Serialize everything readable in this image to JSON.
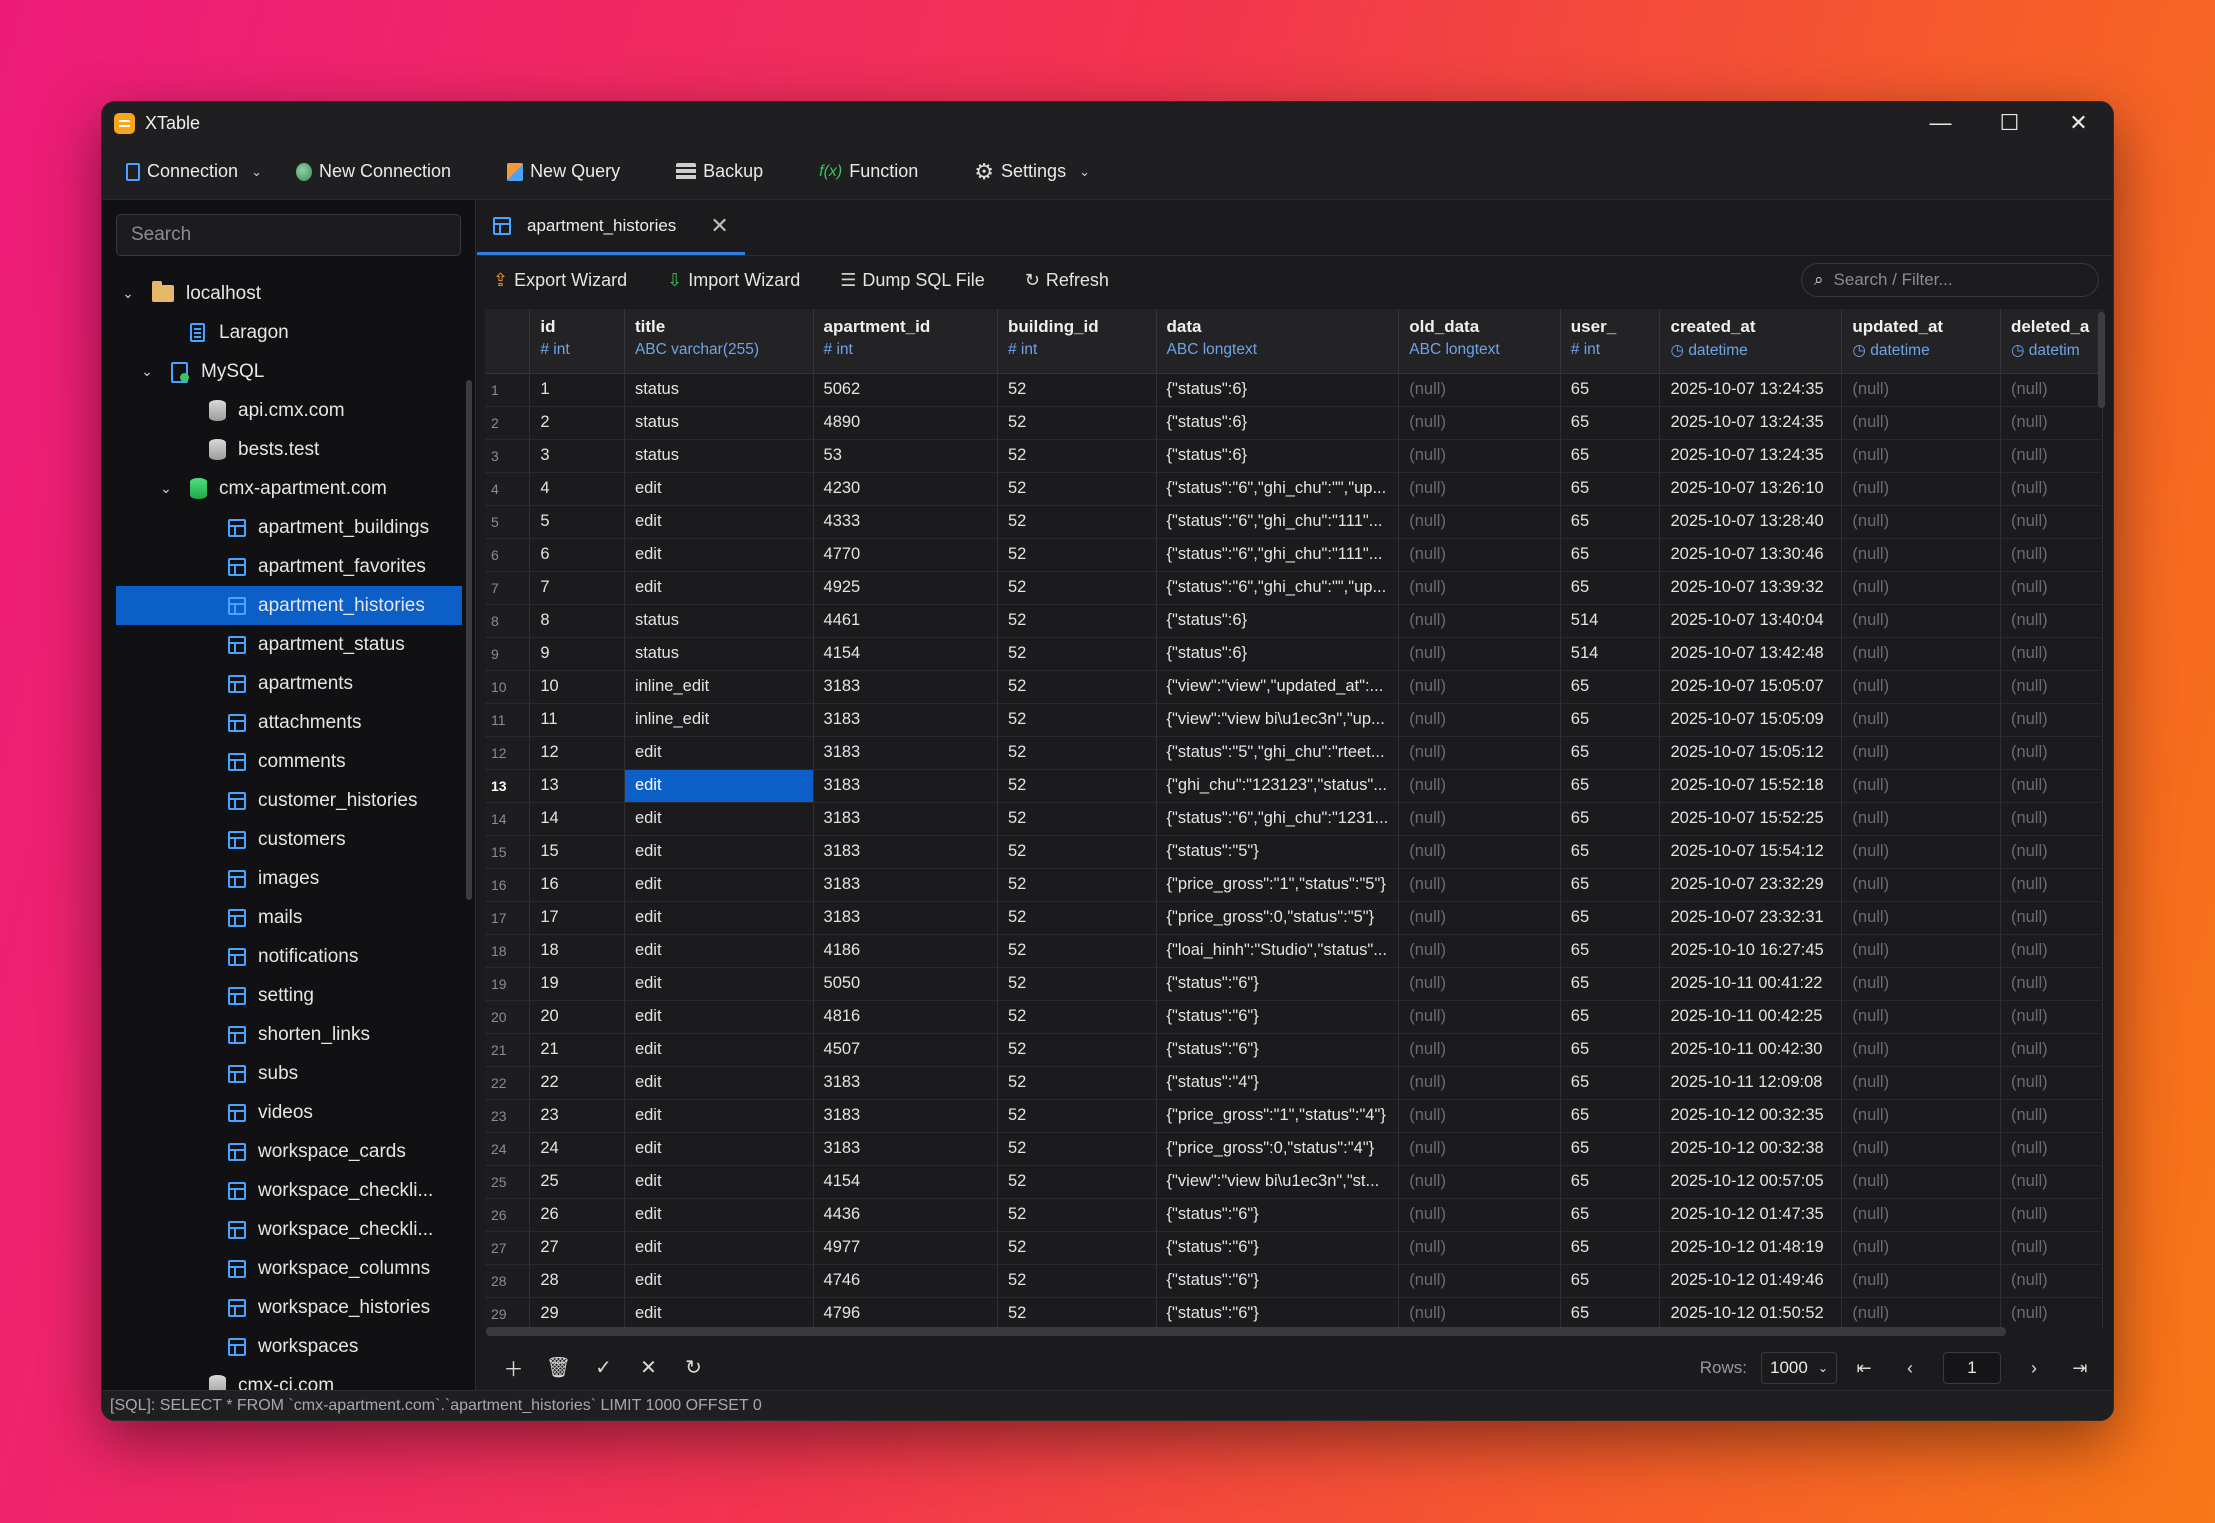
{
  "app": {
    "title": "XTable"
  },
  "window_controls": {
    "minimize": "—",
    "maximize": "☐",
    "close": "✕"
  },
  "toolbar": {
    "connection": "Connection",
    "new_connection": "New Connection",
    "new_query": "New Query",
    "backup": "Backup",
    "function_prefix": "f(x)",
    "function": "Function",
    "settings": "Settings"
  },
  "sidebar": {
    "search_placeholder": "Search",
    "tree": [
      {
        "label": "localhost",
        "icon": "folder-icon",
        "indent": 0,
        "caret": true
      },
      {
        "label": "Laragon",
        "icon": "doc-icon",
        "indent": 2,
        "caret": false
      },
      {
        "label": "MySQL",
        "icon": "mysql-icon",
        "indent": 1,
        "caret": true
      },
      {
        "label": "api.cmx.com",
        "icon": "db-gray",
        "indent": 3,
        "caret": false
      },
      {
        "label": "bests.test",
        "icon": "db-gray",
        "indent": 3,
        "caret": false
      },
      {
        "label": "cmx-apartment.com",
        "icon": "db-green",
        "indent": 2,
        "caret": true
      },
      {
        "label": "apartment_buildings",
        "icon": "table-icon",
        "indent": 4,
        "caret": false
      },
      {
        "label": "apartment_favorites",
        "icon": "table-icon",
        "indent": 4,
        "caret": false
      },
      {
        "label": "apartment_histories",
        "icon": "table-icon",
        "indent": 4,
        "caret": false,
        "selected": true
      },
      {
        "label": "apartment_status",
        "icon": "table-icon",
        "indent": 4,
        "caret": false
      },
      {
        "label": "apartments",
        "icon": "table-icon",
        "indent": 4,
        "caret": false
      },
      {
        "label": "attachments",
        "icon": "table-icon",
        "indent": 4,
        "caret": false
      },
      {
        "label": "comments",
        "icon": "table-icon",
        "indent": 4,
        "caret": false
      },
      {
        "label": "customer_histories",
        "icon": "table-icon",
        "indent": 4,
        "caret": false
      },
      {
        "label": "customers",
        "icon": "table-icon",
        "indent": 4,
        "caret": false
      },
      {
        "label": "images",
        "icon": "table-icon",
        "indent": 4,
        "caret": false
      },
      {
        "label": "mails",
        "icon": "table-icon",
        "indent": 4,
        "caret": false
      },
      {
        "label": "notifications",
        "icon": "table-icon",
        "indent": 4,
        "caret": false
      },
      {
        "label": "setting",
        "icon": "table-icon",
        "indent": 4,
        "caret": false
      },
      {
        "label": "shorten_links",
        "icon": "table-icon",
        "indent": 4,
        "caret": false
      },
      {
        "label": "subs",
        "icon": "table-icon",
        "indent": 4,
        "caret": false
      },
      {
        "label": "videos",
        "icon": "table-icon",
        "indent": 4,
        "caret": false
      },
      {
        "label": "workspace_cards",
        "icon": "table-icon",
        "indent": 4,
        "caret": false
      },
      {
        "label": "workspace_checkli...",
        "icon": "table-icon",
        "indent": 4,
        "caret": false
      },
      {
        "label": "workspace_checkli...",
        "icon": "table-icon",
        "indent": 4,
        "caret": false
      },
      {
        "label": "workspace_columns",
        "icon": "table-icon",
        "indent": 4,
        "caret": false
      },
      {
        "label": "workspace_histories",
        "icon": "table-icon",
        "indent": 4,
        "caret": false
      },
      {
        "label": "workspaces",
        "icon": "table-icon",
        "indent": 4,
        "caret": false
      },
      {
        "label": "cmx-ci.com",
        "icon": "db-gray",
        "indent": 3,
        "caret": false
      }
    ]
  },
  "tab": {
    "label": "apartment_histories",
    "close": "✕"
  },
  "subtoolbar": {
    "export": "Export Wizard",
    "import": "Import Wizard",
    "dump": "Dump SQL File",
    "refresh": "Refresh",
    "filter_placeholder": "Search / Filter..."
  },
  "grid": {
    "columns": [
      {
        "name": "id",
        "type": "# int"
      },
      {
        "name": "title",
        "type": "ABC varchar(255)"
      },
      {
        "name": "apartment_id",
        "type": "# int"
      },
      {
        "name": "building_id",
        "type": "# int"
      },
      {
        "name": "data",
        "type": "ABC longtext"
      },
      {
        "name": "old_data",
        "type": "ABC longtext"
      },
      {
        "name": "user_",
        "type": "# int"
      },
      {
        "name": "created_at",
        "type": "◷ datetime"
      },
      {
        "name": "updated_at",
        "type": "◷ datetime"
      },
      {
        "name": "deleted_a",
        "type": "◷ datetim"
      }
    ],
    "rows": [
      [
        "1",
        "1",
        "status",
        "5062",
        "52",
        "{\"status\":6}",
        "(null)",
        "65",
        "2025-10-07 13:24:35",
        "(null)",
        "(null)"
      ],
      [
        "2",
        "2",
        "status",
        "4890",
        "52",
        "{\"status\":6}",
        "(null)",
        "65",
        "2025-10-07 13:24:35",
        "(null)",
        "(null)"
      ],
      [
        "3",
        "3",
        "status",
        "53",
        "52",
        "{\"status\":6}",
        "(null)",
        "65",
        "2025-10-07 13:24:35",
        "(null)",
        "(null)"
      ],
      [
        "4",
        "4",
        "edit",
        "4230",
        "52",
        "{\"status\":\"6\",\"ghi_chu\":\"\",\"up...",
        "(null)",
        "65",
        "2025-10-07 13:26:10",
        "(null)",
        "(null)"
      ],
      [
        "5",
        "5",
        "edit",
        "4333",
        "52",
        "{\"status\":\"6\",\"ghi_chu\":\"111\"...",
        "(null)",
        "65",
        "2025-10-07 13:28:40",
        "(null)",
        "(null)"
      ],
      [
        "6",
        "6",
        "edit",
        "4770",
        "52",
        "{\"status\":\"6\",\"ghi_chu\":\"111\"...",
        "(null)",
        "65",
        "2025-10-07 13:30:46",
        "(null)",
        "(null)"
      ],
      [
        "7",
        "7",
        "edit",
        "4925",
        "52",
        "{\"status\":\"6\",\"ghi_chu\":\"\",\"up...",
        "(null)",
        "65",
        "2025-10-07 13:39:32",
        "(null)",
        "(null)"
      ],
      [
        "8",
        "8",
        "status",
        "4461",
        "52",
        "{\"status\":6}",
        "(null)",
        "514",
        "2025-10-07 13:40:04",
        "(null)",
        "(null)"
      ],
      [
        "9",
        "9",
        "status",
        "4154",
        "52",
        "{\"status\":6}",
        "(null)",
        "514",
        "2025-10-07 13:42:48",
        "(null)",
        "(null)"
      ],
      [
        "10",
        "10",
        "inline_edit",
        "3183",
        "52",
        "{\"view\":\"view\",\"updated_at\":...",
        "(null)",
        "65",
        "2025-10-07 15:05:07",
        "(null)",
        "(null)"
      ],
      [
        "11",
        "11",
        "inline_edit",
        "3183",
        "52",
        "{\"view\":\"view bi\\u1ec3n\",\"up...",
        "(null)",
        "65",
        "2025-10-07 15:05:09",
        "(null)",
        "(null)"
      ],
      [
        "12",
        "12",
        "edit",
        "3183",
        "52",
        "{\"status\":\"5\",\"ghi_chu\":\"rteet...",
        "(null)",
        "65",
        "2025-10-07 15:05:12",
        "(null)",
        "(null)"
      ],
      [
        "13",
        "13",
        "edit",
        "3183",
        "52",
        "{\"ghi_chu\":\"123123\",\"status\"...",
        "(null)",
        "65",
        "2025-10-07 15:52:18",
        "(null)",
        "(null)"
      ],
      [
        "14",
        "14",
        "edit",
        "3183",
        "52",
        "{\"status\":\"6\",\"ghi_chu\":\"1231...",
        "(null)",
        "65",
        "2025-10-07 15:52:25",
        "(null)",
        "(null)"
      ],
      [
        "15",
        "15",
        "edit",
        "3183",
        "52",
        "{\"status\":\"5\"}",
        "(null)",
        "65",
        "2025-10-07 15:54:12",
        "(null)",
        "(null)"
      ],
      [
        "16",
        "16",
        "edit",
        "3183",
        "52",
        "{\"price_gross\":\"1\",\"status\":\"5\"}",
        "(null)",
        "65",
        "2025-10-07 23:32:29",
        "(null)",
        "(null)"
      ],
      [
        "17",
        "17",
        "edit",
        "3183",
        "52",
        "{\"price_gross\":0,\"status\":\"5\"}",
        "(null)",
        "65",
        "2025-10-07 23:32:31",
        "(null)",
        "(null)"
      ],
      [
        "18",
        "18",
        "edit",
        "4186",
        "52",
        "{\"loai_hinh\":\"Studio\",\"status\"...",
        "(null)",
        "65",
        "2025-10-10 16:27:45",
        "(null)",
        "(null)"
      ],
      [
        "19",
        "19",
        "edit",
        "5050",
        "52",
        "{\"status\":\"6\"}",
        "(null)",
        "65",
        "2025-10-11 00:41:22",
        "(null)",
        "(null)"
      ],
      [
        "20",
        "20",
        "edit",
        "4816",
        "52",
        "{\"status\":\"6\"}",
        "(null)",
        "65",
        "2025-10-11 00:42:25",
        "(null)",
        "(null)"
      ],
      [
        "21",
        "21",
        "edit",
        "4507",
        "52",
        "{\"status\":\"6\"}",
        "(null)",
        "65",
        "2025-10-11 00:42:30",
        "(null)",
        "(null)"
      ],
      [
        "22",
        "22",
        "edit",
        "3183",
        "52",
        "{\"status\":\"4\"}",
        "(null)",
        "65",
        "2025-10-11 12:09:08",
        "(null)",
        "(null)"
      ],
      [
        "23",
        "23",
        "edit",
        "3183",
        "52",
        "{\"price_gross\":\"1\",\"status\":\"4\"}",
        "(null)",
        "65",
        "2025-10-12 00:32:35",
        "(null)",
        "(null)"
      ],
      [
        "24",
        "24",
        "edit",
        "3183",
        "52",
        "{\"price_gross\":0,\"status\":\"4\"}",
        "(null)",
        "65",
        "2025-10-12 00:32:38",
        "(null)",
        "(null)"
      ],
      [
        "25",
        "25",
        "edit",
        "4154",
        "52",
        "{\"view\":\"view bi\\u1ec3n\",\"st...",
        "(null)",
        "65",
        "2025-10-12 00:57:05",
        "(null)",
        "(null)"
      ],
      [
        "26",
        "26",
        "edit",
        "4436",
        "52",
        "{\"status\":\"6\"}",
        "(null)",
        "65",
        "2025-10-12 01:47:35",
        "(null)",
        "(null)"
      ],
      [
        "27",
        "27",
        "edit",
        "4977",
        "52",
        "{\"status\":\"6\"}",
        "(null)",
        "65",
        "2025-10-12 01:48:19",
        "(null)",
        "(null)"
      ],
      [
        "28",
        "28",
        "edit",
        "4746",
        "52",
        "{\"status\":\"6\"}",
        "(null)",
        "65",
        "2025-10-12 01:49:46",
        "(null)",
        "(null)"
      ],
      [
        "29",
        "29",
        "edit",
        "4796",
        "52",
        "{\"status\":\"6\"}",
        "(null)",
        "65",
        "2025-10-12 01:50:52",
        "(null)",
        "(null)"
      ]
    ],
    "selected_row": 13,
    "selected_column": "title"
  },
  "bottom": {
    "rows_label": "Rows:",
    "rows_value": "1000",
    "page": "1"
  },
  "status": {
    "sql": "[SQL]: SELECT * FROM `cmx-apartment.com`.`apartment_histories` LIMIT 1000 OFFSET 0"
  }
}
